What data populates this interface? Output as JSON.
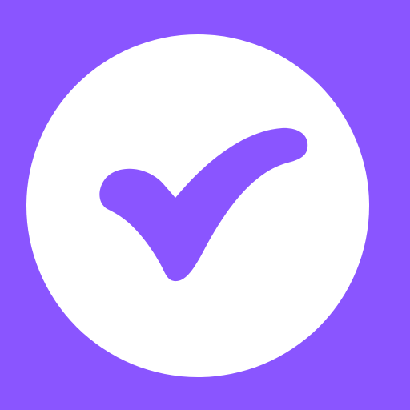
{
  "icon": {
    "name": "checkmark-icon",
    "background_color": "#8A55FF",
    "circle_color": "#FFFFFF",
    "check_color": "#8A55FF"
  }
}
